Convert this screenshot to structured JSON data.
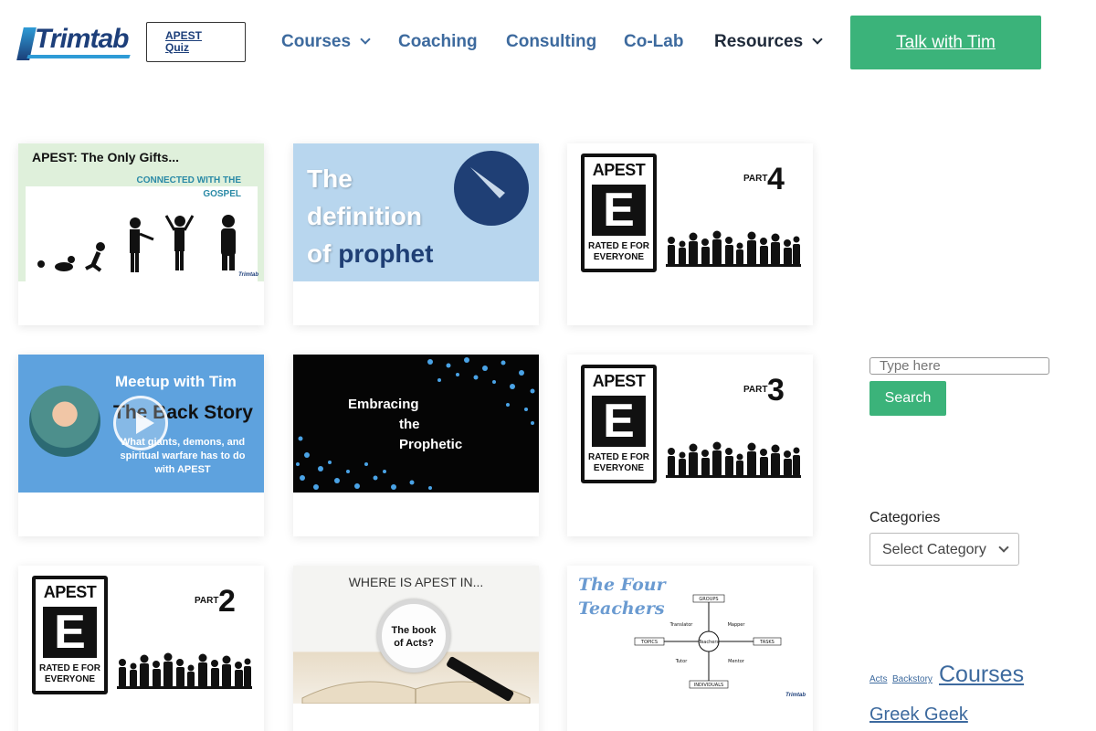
{
  "header": {
    "logo_text": "Trimtab",
    "quiz_button": {
      "line1": "APEST",
      "line2": "Quiz"
    },
    "nav": [
      {
        "label": "Courses",
        "has_dropdown": true
      },
      {
        "label": "Coaching",
        "has_dropdown": false
      },
      {
        "label": "Consulting",
        "has_dropdown": false
      },
      {
        "label": "Co-Lab",
        "has_dropdown": false
      },
      {
        "label": "Resources",
        "has_dropdown": true
      }
    ],
    "cta_label": "Talk with Tim"
  },
  "posts": [
    {
      "title_text": "APEST: The Only Gifts...",
      "subtitle": "CONNECTED WITH THE GOSPEL",
      "brand": "Trimtab"
    },
    {
      "line1": "The",
      "line2": "definition",
      "line3a": "of",
      "line3b": "prophet"
    },
    {
      "apest": "APEST",
      "e": "E",
      "rated": "RATED E FOR EVERYONE",
      "part_label": "PART",
      "part_num": "4"
    },
    {
      "title_text": "Meetup with Tim",
      "story": "The Back Story",
      "subtitle": "What giants, demons, and spiritual warfare has to do with APEST"
    },
    {
      "line1": "Embracing",
      "line2": "the",
      "line3": "Prophetic"
    },
    {
      "apest": "APEST",
      "e": "E",
      "rated": "RATED E FOR EVERYONE",
      "part_label": "PART",
      "part_num": "3"
    },
    {
      "apest": "APEST",
      "e": "E",
      "rated": "RATED E FOR EVERYONE",
      "part_label": "PART",
      "part_num": "2"
    },
    {
      "title_text": "WHERE IS APEST IN...",
      "lens_line1": "The book",
      "lens_line2": "of Acts?"
    },
    {
      "title_line1": "The Four",
      "title_line2": "Teachers",
      "center": "Teachers",
      "labels": [
        "GROUPS",
        "Translator",
        "Mapper",
        "TOPICS",
        "TASKS",
        "Tutor",
        "Mentor",
        "INDIVIDUALS"
      ],
      "brand": "Trimtab"
    }
  ],
  "sidebar": {
    "search_placeholder": "Type here",
    "search_button": "Search",
    "categories_heading": "Categories",
    "categories_select": "Select Category",
    "tags": [
      "Acts",
      "Backstory",
      "Courses",
      "Greek Geek"
    ]
  },
  "colors": {
    "brand_navy": "#1d3f7a",
    "nav_blue": "#3d6a9e",
    "accent_green": "#3bb37a"
  }
}
